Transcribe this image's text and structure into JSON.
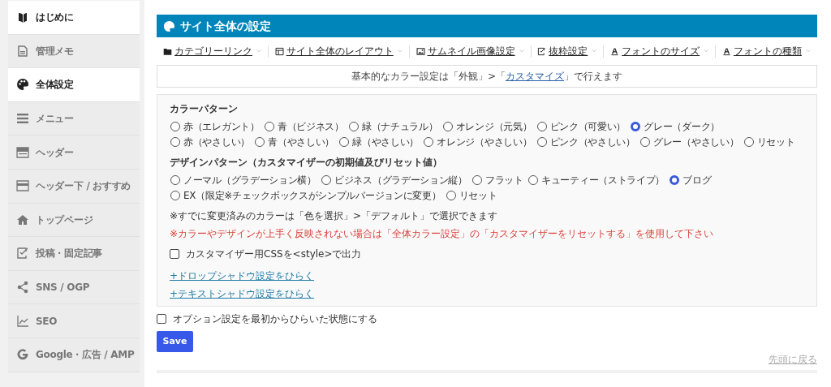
{
  "sidebar": {
    "items": [
      {
        "label": "はじめに",
        "selected": true
      },
      {
        "label": "管理メモ",
        "selected": false
      },
      {
        "label": "全体設定",
        "selected": true
      },
      {
        "label": "メニュー",
        "selected": false
      },
      {
        "label": "ヘッダー",
        "selected": false
      },
      {
        "label": "ヘッダー下 / おすすめ",
        "selected": false
      },
      {
        "label": "トップページ",
        "selected": false
      },
      {
        "label": "投稿・固定記事",
        "selected": false
      },
      {
        "label": "SNS / OGP",
        "selected": false
      },
      {
        "label": "SEO",
        "selected": false
      },
      {
        "label": "Google・広告 / AMP",
        "selected": false
      }
    ]
  },
  "header": {
    "title": "サイト全体の設定"
  },
  "tabs": [
    {
      "label": "カテゴリーリンク"
    },
    {
      "label": "サイト全体のレイアウト"
    },
    {
      "label": "サムネイル画像設定"
    },
    {
      "label": "抜粋設定"
    },
    {
      "label": "フォントのサイズ"
    },
    {
      "label": "フォントの種類"
    }
  ],
  "info": {
    "before": "基本的なカラー設定は「外観」>「",
    "link": "カスタマイズ",
    "after": "」で行えます"
  },
  "color_pattern": {
    "title": "カラーパターン",
    "options": [
      {
        "label": "赤（エレガント）",
        "selected": false
      },
      {
        "label": "青（ビジネス）",
        "selected": false
      },
      {
        "label": "緑（ナチュラル）",
        "selected": false
      },
      {
        "label": "オレンジ（元気）",
        "selected": false
      },
      {
        "label": "ピンク（可愛い）",
        "selected": false
      },
      {
        "label": "グレー（ダーク）",
        "selected": true
      },
      {
        "label": "赤（やさしい）",
        "selected": false
      },
      {
        "label": "青（やさしい）",
        "selected": false
      },
      {
        "label": "緑（やさしい）",
        "selected": false
      },
      {
        "label": "オレンジ（やさしい）",
        "selected": false
      },
      {
        "label": "ピンク（やさしい）",
        "selected": false
      },
      {
        "label": "グレー（やさしい）",
        "selected": false
      },
      {
        "label": "リセット",
        "selected": false
      }
    ]
  },
  "design_pattern": {
    "title": "デザインパターン（カスタマイザーの初期値及びリセット値）",
    "options": [
      {
        "label": "ノーマル（グラデーション横）",
        "selected": false
      },
      {
        "label": "ビジネス（グラデーション縦）",
        "selected": false
      },
      {
        "label": "フラット",
        "selected": false
      },
      {
        "label": "キューティー（ストライプ）",
        "selected": false
      },
      {
        "label": "ブログ",
        "selected": true
      },
      {
        "label": "EX（限定※チェックボックスがシンプルバージョンに変更）",
        "selected": false
      },
      {
        "label": "リセット",
        "selected": false
      }
    ]
  },
  "note": "※すでに変更済みのカラーは「色を選択」>「デフォルト」で選択できます",
  "warning": "※カラーやデザインが上手く反映されない場合は「全体カラー設定」の「カスタマイザーをリセットする」を使用して下さい",
  "css_checkbox": {
    "label": "カスタマイザー用CSSを<style>で出力",
    "checked": false
  },
  "expanders": [
    {
      "label": "+ドロップシャドウ設定をひらく"
    },
    {
      "label": "+テキストシャドウ設定をひらく"
    }
  ],
  "option_checkbox": {
    "label": "オプション設定を最初からひらいた状態にする",
    "checked": false
  },
  "save_button": "Save",
  "back_to_top": "先頭に戻る"
}
